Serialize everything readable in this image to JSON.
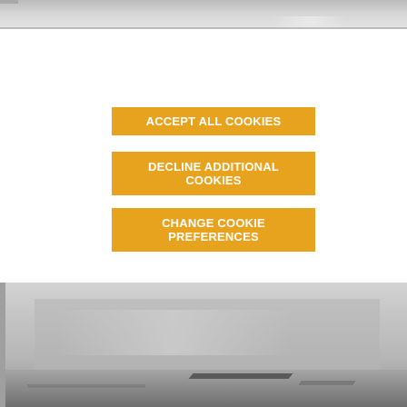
{
  "consent": {
    "accept_all_label": "ACCEPT ALL COOKIES",
    "decline_additional_label_line1": "DECLINE ADDITIONAL",
    "decline_additional_label_line2": "COOKIES",
    "change_preferences_label_line1": "CHANGE COOKIE",
    "change_preferences_label_line2": "PREFERENCES"
  },
  "colors": {
    "button_background": "#e8a31e",
    "button_text": "#ffffff",
    "page_background": "#ffffff"
  }
}
